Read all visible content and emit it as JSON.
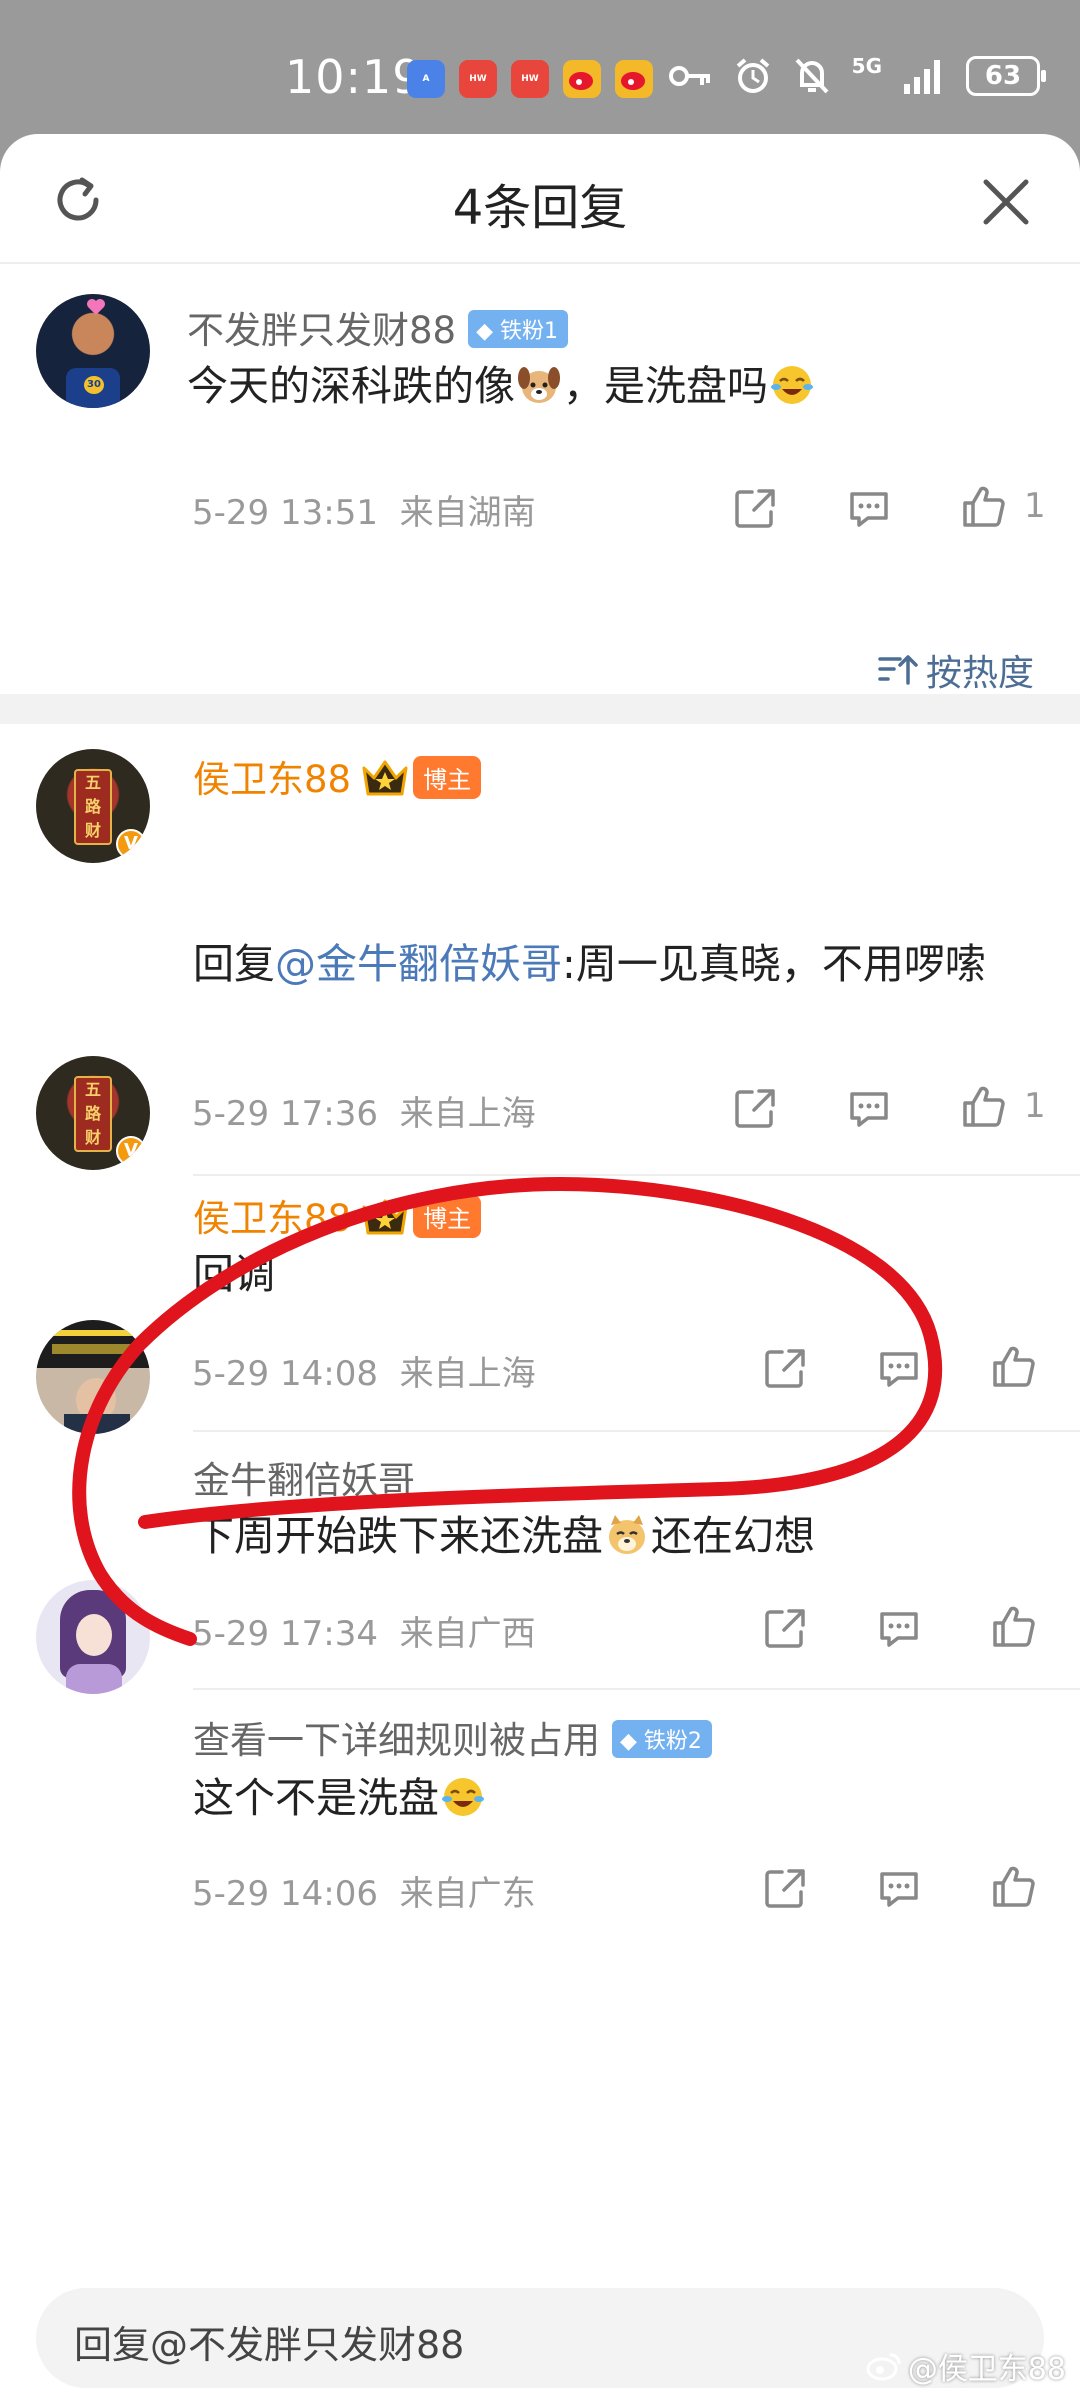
{
  "status_bar": {
    "time": "10:19",
    "battery": "63",
    "network": "5G"
  },
  "sheet": {
    "title": "4条回复",
    "sort_label": "按热度"
  },
  "original": {
    "name": "不发胖只发财88",
    "fan_badge": "铁粉1",
    "text_before": "今天的深科跌的像",
    "text_mid": "，是洗盘吗",
    "date": "5-29 13:51",
    "location": "来自湖南",
    "likes": "1"
  },
  "replies": [
    {
      "name": "侯卫东88",
      "host_badge": "博主",
      "reply_prefix": "回复",
      "mention": "@金牛翻倍妖哥",
      "text": ":周一见真晓，不用啰嗦",
      "date": "5-29 17:36",
      "location": "来自上海",
      "likes": "1"
    },
    {
      "name": "侯卫东88",
      "host_badge": "博主",
      "text": "回调",
      "date": "5-29 14:08",
      "location": "来自上海"
    },
    {
      "name": "金牛翻倍妖哥",
      "text_before": "下周开始跌下来还洗盘",
      "text_after": "还在幻想",
      "date": "5-29 17:34",
      "location": "来自广西"
    },
    {
      "name": "查看一下详细规则被占用",
      "fan_badge": "铁粉2",
      "text": "这个不是洗盘",
      "date": "5-29 14:06",
      "location": "来自广东"
    }
  ],
  "input": {
    "placeholder": "回复@不发胖只发财88"
  },
  "watermark": "@侯卫东88",
  "colors": {
    "host_orange": "#f08300",
    "mention_blue": "#4c7ab8",
    "annotation_red": "#e0141c"
  }
}
